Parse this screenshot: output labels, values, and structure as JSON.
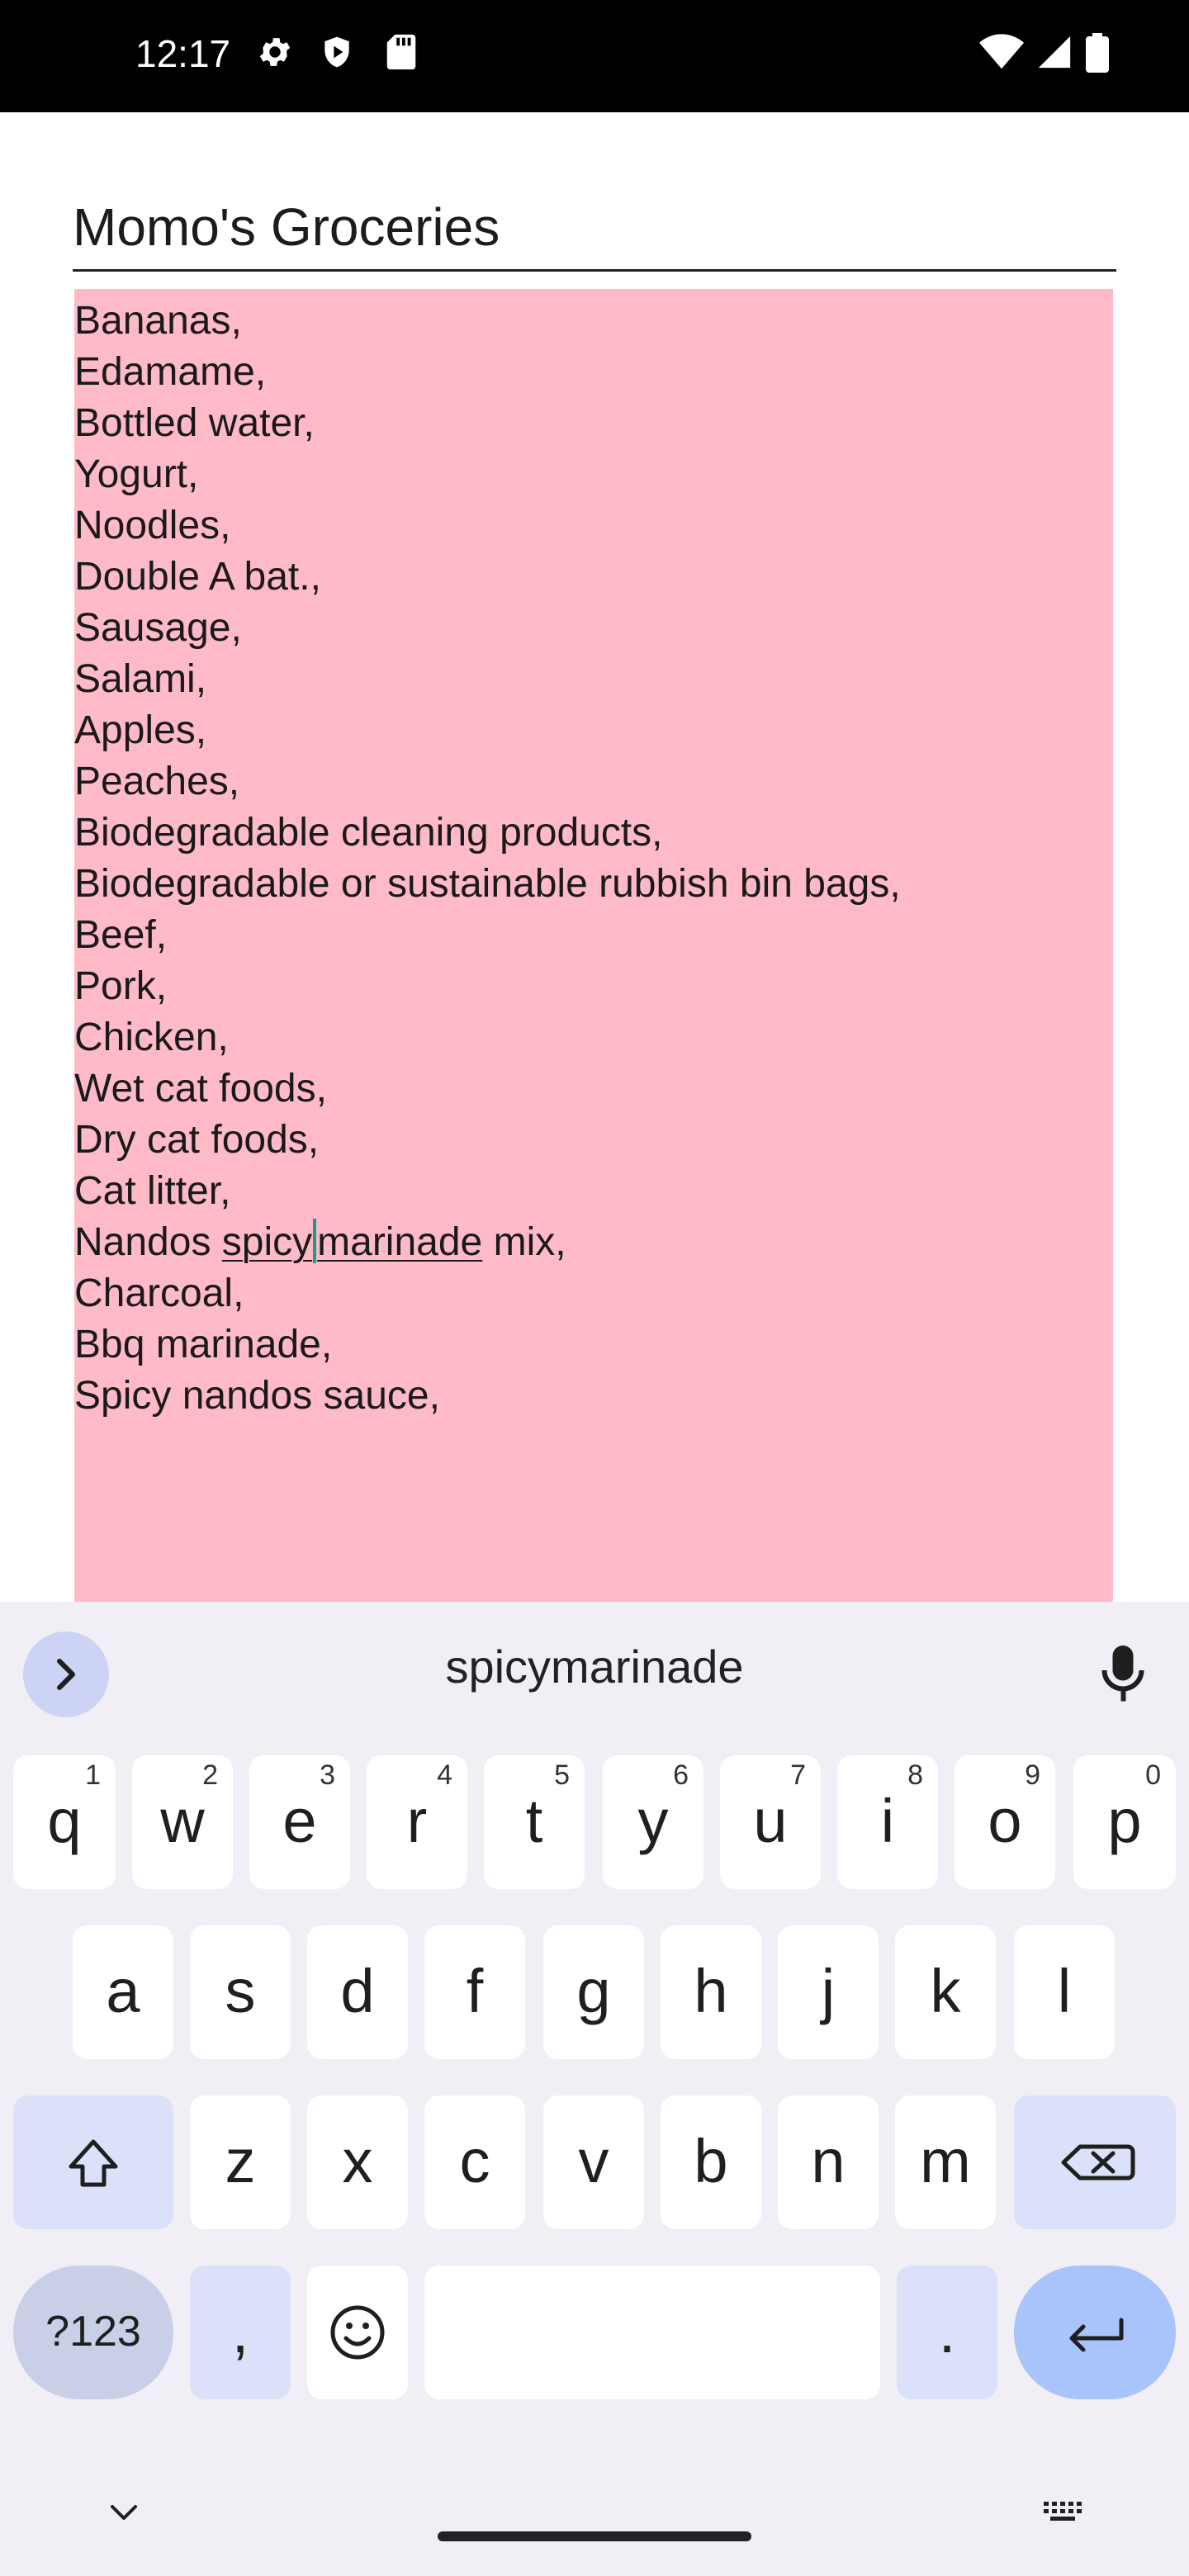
{
  "status_bar": {
    "time": "12:17"
  },
  "note": {
    "title": "Momo's Groceries",
    "lines": [
      "Bananas,",
      "Edamame,",
      "Bottled water,",
      "Yogurt,",
      "Noodles,",
      "Double A bat.,",
      "Sausage,",
      "Salami,",
      "Apples,",
      "Peaches,",
      "Biodegradable cleaning products,",
      "Biodegradable or sustainable rubbish bin bags,",
      "Beef,",
      "Pork,",
      "Chicken,",
      "Wet cat foods,",
      "Dry cat foods,",
      "Cat litter,"
    ],
    "editing_line": {
      "prefix": "Nandos ",
      "word_before_caret": "spicy",
      "word_after_caret": "marinade",
      "suffix": " mix,"
    },
    "lines_after": [
      "Charcoal,",
      "Bbq marinade,",
      "Spicy nandos sauce,"
    ],
    "background_color": "#ffbac8"
  },
  "keyboard": {
    "suggestion": "spicymarinade",
    "row1": [
      {
        "k": "q",
        "h": "1"
      },
      {
        "k": "w",
        "h": "2"
      },
      {
        "k": "e",
        "h": "3"
      },
      {
        "k": "r",
        "h": "4"
      },
      {
        "k": "t",
        "h": "5"
      },
      {
        "k": "y",
        "h": "6"
      },
      {
        "k": "u",
        "h": "7"
      },
      {
        "k": "i",
        "h": "8"
      },
      {
        "k": "o",
        "h": "9"
      },
      {
        "k": "p",
        "h": "0"
      }
    ],
    "row2": [
      "a",
      "s",
      "d",
      "f",
      "g",
      "h",
      "j",
      "k",
      "l"
    ],
    "row3": [
      "z",
      "x",
      "c",
      "v",
      "b",
      "n",
      "m"
    ],
    "symbols_label": "?123",
    "comma_label": ",",
    "period_label": ".",
    "icons": [
      "settings-icon",
      "shield-icon",
      "sd-card-icon",
      "wifi-icon",
      "signal-icon",
      "battery-icon",
      "chevron-right-icon",
      "mic-icon",
      "shift-icon",
      "backspace-icon",
      "emoji-icon",
      "enter-icon",
      "chevron-down-icon",
      "keyboard-icon"
    ]
  }
}
